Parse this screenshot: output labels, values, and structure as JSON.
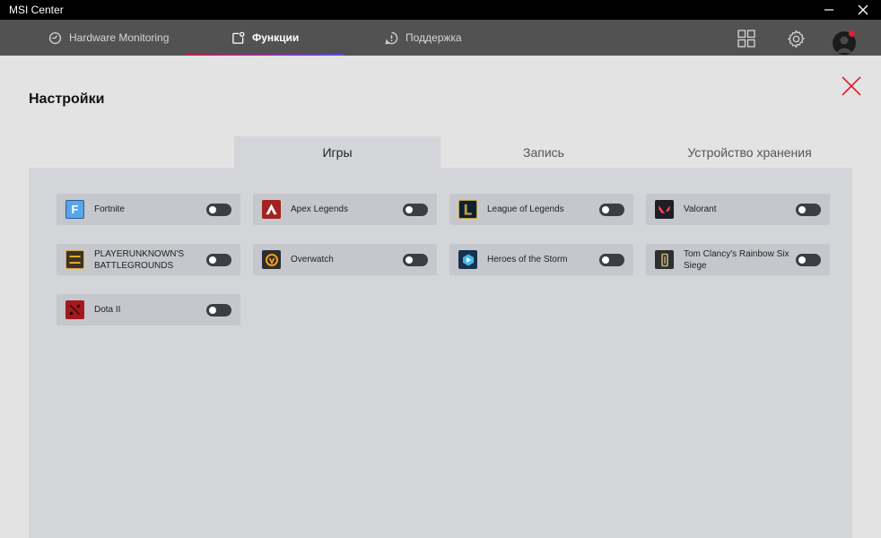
{
  "window": {
    "title": "MSI Center"
  },
  "nav": {
    "tabs": [
      {
        "label": "Hardware Monitoring"
      },
      {
        "label": "Функции"
      },
      {
        "label": "Поддержка"
      }
    ]
  },
  "settings": {
    "title": "Настройки",
    "tabs": [
      {
        "label": "Игры"
      },
      {
        "label": "Запись"
      },
      {
        "label": "Устройство хранения"
      }
    ]
  },
  "games": [
    {
      "name": "Fortnite",
      "icon": "fortnite-icon",
      "enabled": false
    },
    {
      "name": "Apex Legends",
      "icon": "apex-legends-icon",
      "enabled": false
    },
    {
      "name": "League of Legends",
      "icon": "league-of-legends-icon",
      "enabled": false
    },
    {
      "name": "Valorant",
      "icon": "valorant-icon",
      "enabled": false
    },
    {
      "name": "PLAYERUNKNOWN'S BATTLEGROUNDS",
      "icon": "pubg-icon",
      "enabled": false
    },
    {
      "name": "Overwatch",
      "icon": "overwatch-icon",
      "enabled": false
    },
    {
      "name": "Heroes of the Storm",
      "icon": "heroes-of-the-storm-icon",
      "enabled": false
    },
    {
      "name": "Tom Clancy's Rainbow Six Siege",
      "icon": "rainbow-six-siege-icon",
      "enabled": false
    },
    {
      "name": "Dota II",
      "icon": "dota-2-icon",
      "enabled": false
    }
  ],
  "colors": {
    "accent_red": "#e0202e",
    "nav_bg": "#525252",
    "panel_bg": "#d4d5d9",
    "card_bg": "#c5c7cc"
  }
}
